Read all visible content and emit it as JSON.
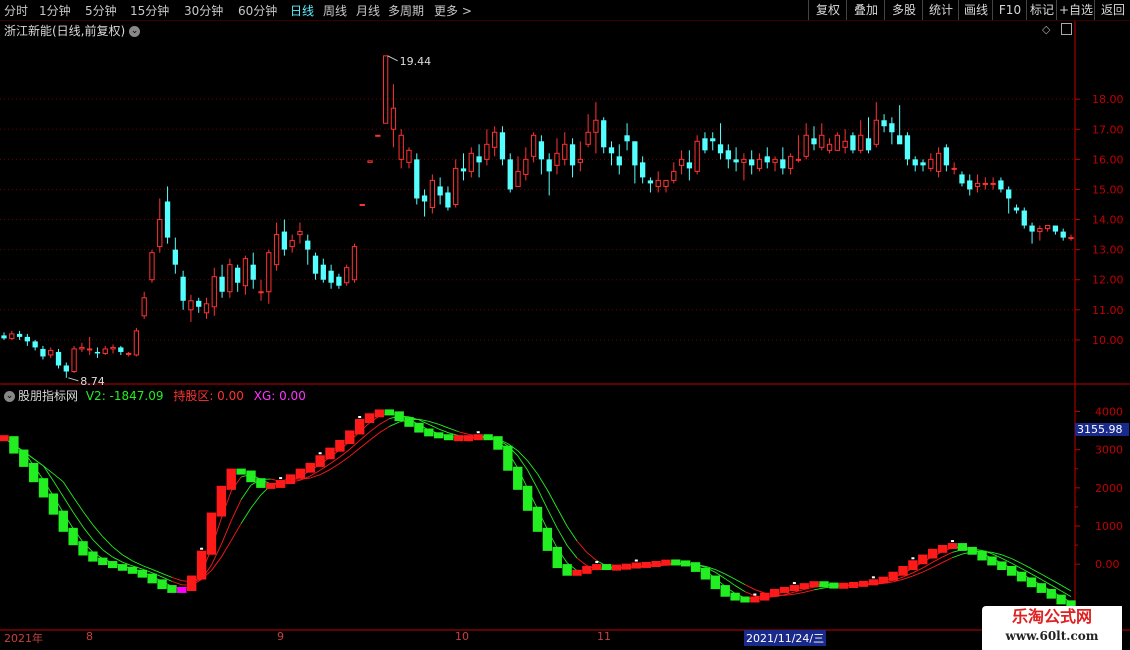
{
  "toolbar": {
    "periods": [
      "分时",
      "1分钟",
      "5分钟",
      "15分钟",
      "30分钟",
      "60分钟",
      "日线",
      "周线",
      "月线",
      "多周期",
      "更多 >"
    ],
    "active_period": "日线",
    "right_buttons": [
      "复权",
      "叠加",
      "多股",
      "统计",
      "画线",
      "F10",
      "标记",
      "+自选",
      "返回"
    ]
  },
  "stock": {
    "title": "浙江新能(日线,前复权)",
    "dropdown_icon": "chevron-down-icon"
  },
  "indicator": {
    "name": "股朋指标网",
    "v2_text": "V2: -1847.09",
    "hold_text": "持股区: 0.00",
    "xg_text": "XG: 0.00"
  },
  "colors": {
    "up": "#ff3232",
    "down": "#54ffff",
    "ind_up": "#ff1a1a",
    "ind_down": "#22ee22",
    "ind_mark": "#ff00ff",
    "axis": "#c00000",
    "grid": "#6a0000"
  },
  "chart_data": [
    {
      "type": "candlestick",
      "title": "浙江新能(日线,前复权)",
      "y_ticks": [
        "18.00",
        "17.00",
        "16.00",
        "15.00",
        "14.00",
        "13.00",
        "12.00",
        "11.00",
        "10.00"
      ],
      "ylim": [
        9.0,
        19.9
      ],
      "annotations": [
        {
          "text": "19.44",
          "kind": "high"
        },
        {
          "text": "8.74",
          "kind": "low"
        }
      ],
      "candles": [
        [
          10.15,
          10.05,
          10.25,
          10.0
        ],
        [
          10.05,
          10.2,
          10.3,
          10.0
        ],
        [
          10.2,
          10.1,
          10.3,
          10.0
        ],
        [
          10.1,
          9.95,
          10.2,
          9.8
        ],
        [
          9.95,
          9.75,
          10.0,
          9.65
        ],
        [
          9.7,
          9.45,
          9.8,
          9.35
        ],
        [
          9.5,
          9.65,
          9.75,
          9.4
        ],
        [
          9.6,
          9.15,
          9.7,
          9.05
        ],
        [
          9.15,
          8.95,
          9.25,
          8.74
        ],
        [
          8.95,
          9.7,
          9.8,
          8.9
        ],
        [
          9.7,
          9.75,
          9.9,
          9.6
        ],
        [
          9.7,
          9.7,
          10.1,
          9.5
        ],
        [
          9.6,
          9.55,
          9.75,
          9.4
        ],
        [
          9.55,
          9.7,
          9.8,
          9.5
        ],
        [
          9.7,
          9.75,
          9.85,
          9.55
        ],
        [
          9.75,
          9.6,
          9.8,
          9.5
        ],
        [
          9.55,
          9.55,
          9.6,
          9.45
        ],
        [
          9.5,
          10.3,
          10.4,
          9.45
        ],
        [
          10.8,
          11.4,
          11.6,
          10.7
        ],
        [
          12.0,
          12.9,
          13.0,
          11.9
        ],
        [
          13.1,
          14.0,
          14.7,
          12.9
        ],
        [
          14.6,
          13.4,
          15.1,
          13.2
        ],
        [
          13.0,
          12.5,
          13.4,
          12.2
        ],
        [
          12.1,
          11.3,
          12.3,
          11.0
        ],
        [
          11.0,
          11.3,
          11.5,
          10.6
        ],
        [
          11.3,
          11.1,
          11.4,
          10.9
        ],
        [
          10.9,
          11.2,
          11.4,
          10.7
        ],
        [
          11.1,
          12.1,
          12.4,
          10.8
        ],
        [
          12.1,
          11.6,
          12.5,
          11.4
        ],
        [
          11.6,
          12.5,
          12.7,
          11.4
        ],
        [
          12.4,
          11.9,
          12.5,
          11.6
        ],
        [
          11.8,
          12.7,
          12.8,
          11.5
        ],
        [
          12.5,
          12.0,
          12.9,
          11.7
        ],
        [
          11.6,
          11.6,
          12.0,
          11.3
        ],
        [
          11.6,
          12.9,
          13.0,
          11.2
        ],
        [
          12.5,
          13.5,
          13.9,
          12.3
        ],
        [
          13.6,
          13.0,
          14.0,
          12.8
        ],
        [
          13.1,
          13.3,
          13.5,
          12.9
        ],
        [
          13.5,
          13.6,
          13.9,
          13.2
        ],
        [
          13.3,
          13.0,
          13.5,
          12.5
        ],
        [
          12.8,
          12.2,
          12.9,
          12.0
        ],
        [
          12.5,
          12.0,
          12.7,
          11.9
        ],
        [
          12.3,
          11.9,
          12.5,
          11.7
        ],
        [
          12.1,
          11.8,
          12.2,
          11.7
        ],
        [
          11.9,
          12.4,
          12.5,
          11.8
        ],
        [
          12.0,
          13.1,
          13.2,
          11.9
        ],
        [
          14.5,
          14.5,
          14.5,
          14.5
        ],
        [
          15.9,
          15.95,
          15.95,
          15.9
        ],
        [
          16.8,
          16.8,
          16.8,
          16.8
        ],
        [
          17.2,
          19.44,
          19.44,
          17.2
        ],
        [
          17.0,
          17.7,
          18.5,
          16.4
        ],
        [
          16.0,
          16.8,
          17.0,
          15.7
        ],
        [
          15.9,
          16.3,
          16.4,
          15.7
        ],
        [
          16.0,
          14.7,
          16.2,
          14.5
        ],
        [
          14.8,
          14.6,
          15.0,
          14.1
        ],
        [
          14.4,
          15.3,
          15.5,
          14.2
        ],
        [
          15.1,
          14.8,
          15.4,
          14.5
        ],
        [
          14.9,
          14.4,
          15.1,
          14.3
        ],
        [
          14.5,
          15.7,
          16.0,
          14.4
        ],
        [
          15.7,
          15.6,
          16.2,
          15.3
        ],
        [
          15.6,
          16.2,
          16.4,
          15.4
        ],
        [
          16.1,
          15.9,
          16.5,
          15.4
        ],
        [
          16.0,
          16.5,
          17.0,
          15.8
        ],
        [
          16.4,
          16.9,
          17.1,
          16.1
        ],
        [
          16.9,
          16.0,
          17.1,
          15.8
        ],
        [
          16.0,
          15.0,
          16.2,
          14.9
        ],
        [
          15.1,
          15.6,
          16.1,
          15.1
        ],
        [
          15.5,
          16.0,
          16.4,
          15.3
        ],
        [
          16.1,
          16.8,
          16.9,
          15.9
        ],
        [
          16.6,
          16.0,
          16.8,
          15.5
        ],
        [
          16.0,
          15.6,
          16.2,
          14.8
        ],
        [
          15.8,
          16.2,
          16.7,
          15.5
        ],
        [
          16.0,
          16.5,
          16.9,
          15.8
        ],
        [
          16.5,
          15.8,
          16.7,
          15.4
        ],
        [
          15.9,
          16.0,
          16.6,
          15.6
        ],
        [
          16.5,
          16.9,
          17.5,
          16.4
        ],
        [
          16.9,
          17.3,
          17.9,
          16.2
        ],
        [
          17.3,
          16.4,
          17.4,
          16.2
        ],
        [
          16.4,
          16.2,
          16.6,
          15.8
        ],
        [
          16.1,
          15.8,
          16.5,
          15.5
        ],
        [
          16.8,
          16.6,
          17.2,
          16.3
        ],
        [
          16.6,
          15.8,
          16.6,
          15.2
        ],
        [
          15.9,
          15.4,
          16.1,
          15.2
        ],
        [
          15.3,
          15.2,
          15.4,
          14.9
        ],
        [
          15.1,
          15.3,
          15.6,
          14.9
        ],
        [
          15.1,
          15.3,
          15.3,
          14.9
        ],
        [
          15.3,
          15.6,
          15.9,
          15.2
        ],
        [
          15.8,
          16.0,
          16.3,
          15.5
        ],
        [
          15.9,
          15.7,
          16.3,
          15.3
        ],
        [
          15.6,
          16.6,
          16.8,
          15.5
        ],
        [
          16.7,
          16.3,
          16.9,
          16.2
        ],
        [
          16.7,
          16.6,
          16.9,
          16.3
        ],
        [
          16.5,
          16.2,
          17.2,
          16.0
        ],
        [
          16.3,
          16.0,
          16.5,
          15.7
        ],
        [
          16.0,
          15.9,
          16.4,
          15.6
        ],
        [
          15.9,
          16.0,
          16.2,
          15.3
        ],
        [
          16.0,
          15.8,
          16.3,
          15.5
        ],
        [
          15.7,
          16.0,
          16.2,
          15.6
        ],
        [
          16.1,
          15.9,
          16.4,
          15.7
        ],
        [
          15.9,
          16.0,
          16.1,
          15.6
        ],
        [
          16.0,
          15.7,
          16.4,
          15.5
        ],
        [
          15.7,
          16.1,
          16.2,
          15.5
        ],
        [
          16.0,
          16.0,
          16.8,
          15.9
        ],
        [
          16.1,
          16.8,
          17.2,
          16.0
        ],
        [
          16.7,
          16.5,
          17.1,
          16.3
        ],
        [
          16.4,
          16.8,
          17.2,
          16.3
        ],
        [
          16.3,
          16.5,
          16.7,
          16.2
        ],
        [
          16.3,
          16.8,
          16.9,
          16.3
        ],
        [
          16.4,
          16.6,
          17.0,
          16.2
        ],
        [
          16.8,
          16.3,
          16.9,
          16.2
        ],
        [
          16.3,
          16.8,
          17.3,
          16.2
        ],
        [
          16.7,
          16.3,
          17.4,
          16.2
        ],
        [
          16.5,
          17.3,
          17.9,
          16.4
        ],
        [
          17.3,
          17.1,
          17.5,
          16.9
        ],
        [
          17.2,
          16.9,
          17.4,
          16.5
        ],
        [
          16.8,
          16.5,
          17.8,
          16.6
        ],
        [
          16.8,
          16.0,
          16.9,
          15.8
        ],
        [
          16.0,
          15.8,
          16.1,
          15.6
        ],
        [
          15.9,
          15.8,
          16.0,
          15.6
        ],
        [
          15.7,
          16.0,
          16.2,
          15.6
        ],
        [
          15.6,
          16.2,
          16.4,
          15.4
        ],
        [
          16.4,
          15.8,
          16.5,
          15.6
        ],
        [
          15.7,
          15.7,
          15.9,
          15.5
        ],
        [
          15.5,
          15.2,
          15.6,
          15.1
        ],
        [
          15.3,
          15.0,
          15.5,
          14.8
        ],
        [
          15.1,
          15.2,
          15.5,
          14.9
        ],
        [
          15.2,
          15.2,
          15.4,
          15.0
        ],
        [
          15.2,
          15.2,
          15.4,
          15.0
        ],
        [
          15.3,
          15.0,
          15.4,
          14.9
        ],
        [
          15.0,
          14.7,
          15.1,
          14.2
        ],
        [
          14.4,
          14.3,
          14.5,
          14.2
        ],
        [
          14.3,
          13.8,
          14.4,
          13.7
        ],
        [
          13.8,
          13.6,
          13.9,
          13.2
        ],
        [
          13.6,
          13.7,
          13.8,
          13.3
        ],
        [
          13.7,
          13.8,
          13.8,
          13.6
        ],
        [
          13.8,
          13.6,
          13.8,
          13.5
        ],
        [
          13.6,
          13.4,
          13.7,
          13.3
        ],
        [
          13.4,
          13.4,
          13.5,
          13.3
        ]
      ]
    },
    {
      "type": "line",
      "title": "股朋指标网",
      "y_ticks": [
        "4000",
        "3000",
        "2000",
        "1000",
        "0.00"
      ],
      "ylim": [
        -1200,
        4300
      ],
      "current_value_label": "3155.98",
      "x_tick_labels": [
        "2021年",
        "8",
        "9",
        "10",
        "11"
      ],
      "cursor_date": "2021/11/24/三",
      "v2_line": [
        3300,
        2950,
        2600,
        2200,
        1800,
        1350,
        900,
        550,
        280,
        120,
        30,
        -50,
        -120,
        -200,
        -300,
        -450,
        -600,
        -700,
        -650,
        -350,
        300,
        1300,
        2000,
        2450,
        2400,
        2200,
        2050,
        2050,
        2150,
        2300,
        2450,
        2600,
        2800,
        3000,
        3200,
        3450,
        3750,
        3900,
        4000,
        3950,
        3800,
        3650,
        3500,
        3400,
        3350,
        3300,
        3300,
        3300,
        3350,
        3300,
        3050,
        2500,
        2000,
        1450,
        900,
        400,
        -50,
        -250,
        -200,
        -100,
        -50,
        -100,
        -80,
        -50,
        -20,
        -20,
        30,
        50,
        40,
        0,
        -150,
        -350,
        -600,
        -800,
        -900,
        -950,
        -900,
        -800,
        -700,
        -650,
        -600,
        -550,
        -500,
        -550,
        -570,
        -560,
        -530,
        -500,
        -450,
        -380,
        -250,
        -100,
        50,
        200,
        350,
        450,
        500,
        400,
        300,
        150,
        20,
        -100,
        -250,
        -400,
        -550,
        -700,
        -850,
        -1000,
        -1150
      ],
      "signals": [
        {
          "index": 18,
          "kind": "mark"
        }
      ]
    }
  ],
  "watermark": {
    "title": "乐淘公式网",
    "url": "www.60lt.com"
  }
}
